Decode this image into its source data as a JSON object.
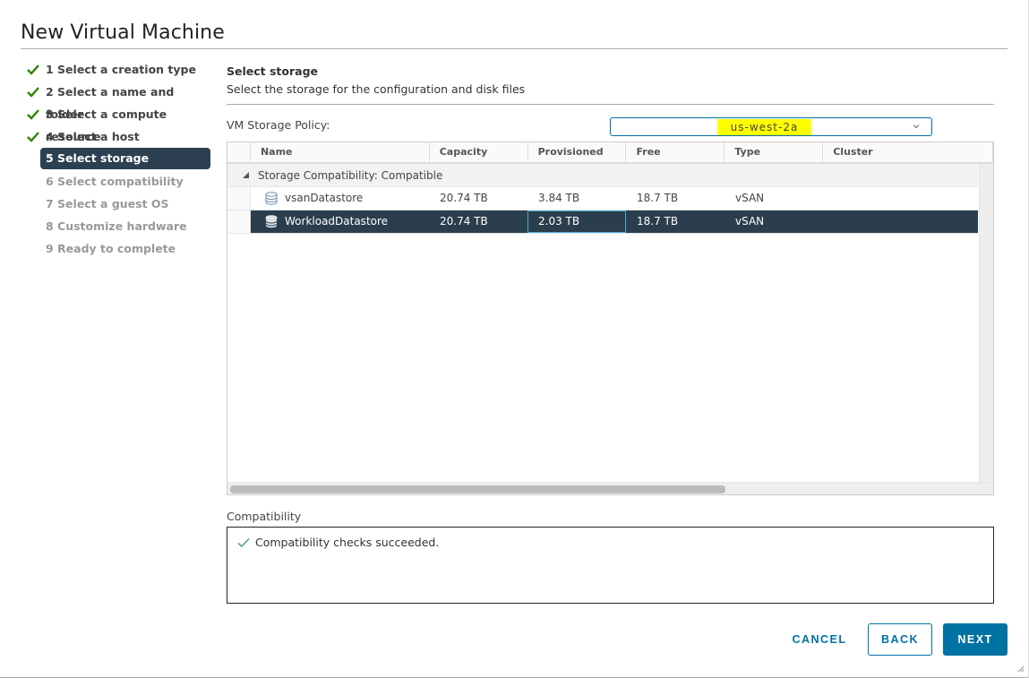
{
  "dialog": {
    "title": "New Virtual Machine"
  },
  "steps": [
    {
      "label": "1 Select a creation type",
      "state": "done"
    },
    {
      "label": "2 Select a name and folder",
      "state": "done"
    },
    {
      "label": "3 Select a compute resource",
      "state": "done"
    },
    {
      "label": "4 Select a host",
      "state": "done"
    },
    {
      "label": "5 Select storage",
      "state": "active"
    },
    {
      "label": "6 Select compatibility",
      "state": "pending"
    },
    {
      "label": "7 Select a guest OS",
      "state": "pending"
    },
    {
      "label": "8 Customize hardware",
      "state": "pending"
    },
    {
      "label": "9 Ready to complete",
      "state": "pending"
    }
  ],
  "main": {
    "title": "Select storage",
    "subtitle": "Select the storage for the configuration and disk files",
    "policy_label": "VM Storage Policy:",
    "policy_value": "us-west-2a",
    "policy_highlight": "#ffff00"
  },
  "grid": {
    "columns": [
      "Name",
      "Capacity",
      "Provisioned",
      "Free",
      "Type",
      "Cluster"
    ],
    "group": "Storage Compatibility: Compatible",
    "rows": [
      {
        "name": "vsanDatastore",
        "capacity": "20.74 TB",
        "provisioned": "3.84 TB",
        "free": "18.7 TB",
        "type": "vSAN",
        "cluster": "",
        "selected": false
      },
      {
        "name": "WorkloadDatastore",
        "capacity": "20.74 TB",
        "provisioned": "2.03 TB",
        "free": "18.7 TB",
        "type": "vSAN",
        "cluster": "",
        "selected": true
      }
    ]
  },
  "compatibility": {
    "label": "Compatibility",
    "message": "Compatibility checks succeeded."
  },
  "footer": {
    "cancel": "CANCEL",
    "back": "BACK",
    "next": "NEXT"
  },
  "colors": {
    "accent": "#0072a3",
    "selected_row": "#2b3e4d",
    "check_green": "#2f8400"
  }
}
